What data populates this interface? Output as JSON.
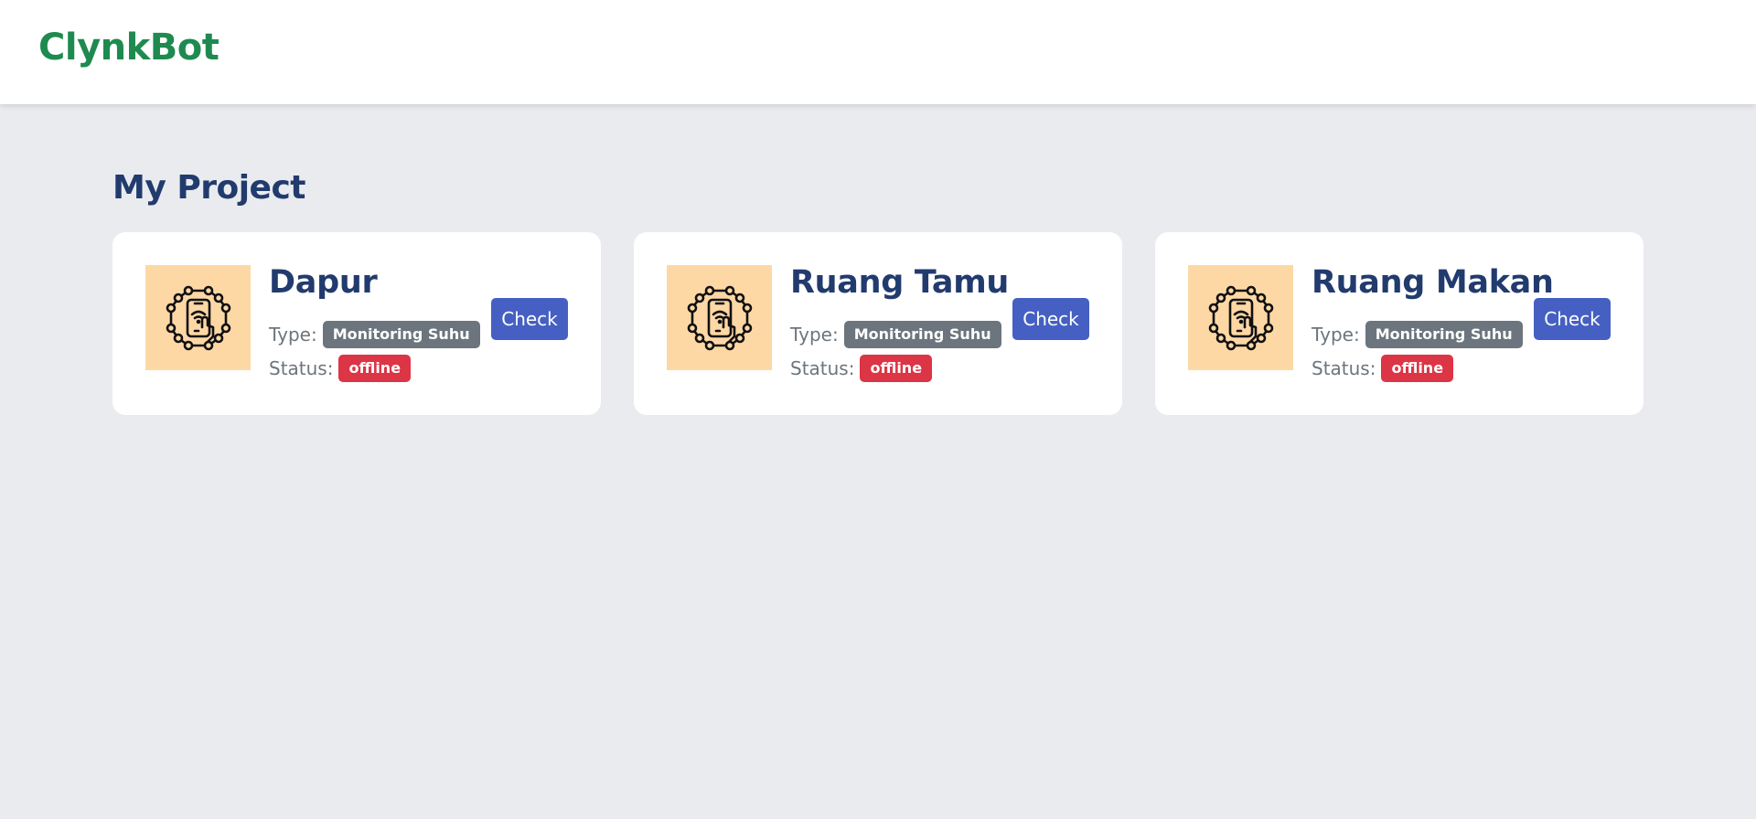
{
  "app": {
    "brand": "ClynkBot"
  },
  "page": {
    "title": "My Project"
  },
  "labels": {
    "type_label": "Type:",
    "status_label": "Status:"
  },
  "projects": [
    {
      "name": "Dapur",
      "type": "Monitoring Suhu",
      "status": "offline",
      "action_label": "Check",
      "icon": "iot-smartphone-network-icon"
    },
    {
      "name": "Ruang Tamu",
      "type": "Monitoring Suhu",
      "status": "offline",
      "action_label": "Check",
      "icon": "iot-smartphone-network-icon"
    },
    {
      "name": "Ruang Makan",
      "type": "Monitoring Suhu",
      "status": "offline",
      "action_label": "Check",
      "icon": "iot-smartphone-network-icon"
    }
  ],
  "colors": {
    "brand": "#1e8a4f",
    "heading": "#223b6e",
    "thumb_background": "#fdd8a5",
    "type_badge": "#6c757d",
    "status_offline": "#dc3545",
    "primary_button": "#4560c2",
    "page_background": "#e9ebee"
  }
}
